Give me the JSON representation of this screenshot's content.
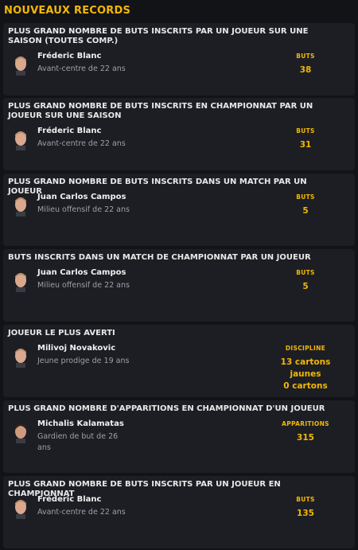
{
  "header": {
    "title": "NOUVEAUX RECORDS"
  },
  "records": [
    {
      "title": "PLUS GRAND NOMBRE DE BUTS INSCRITS PAR UN JOUEUR SUR UNE SAISON (TOUTES COMP.)",
      "player": "Fréderic Blanc",
      "desc": "Avant-centre de 22 ans",
      "stat_label": "BUTS",
      "stat_value": "38",
      "avatar_icon": "player-face-light-hair"
    },
    {
      "title": "PLUS GRAND NOMBRE DE BUTS INSCRITS EN CHAMPIONNAT PAR UN JOUEUR SUR UNE SAISON",
      "player": "Fréderic Blanc",
      "desc": "Avant-centre de 22 ans",
      "stat_label": "BUTS",
      "stat_value": "31",
      "avatar_icon": "player-face-light-hair"
    },
    {
      "title": "PLUS GRAND NOMBRE DE BUTS INSCRITS DANS UN MATCH PAR UN JOUEUR",
      "player": "Juan Carlos Campos",
      "desc": "Milieu offensif de 22 ans",
      "stat_label": "BUTS",
      "stat_value": "5",
      "avatar_icon": "player-face-light-hair"
    },
    {
      "title": "BUTS INSCRITS DANS UN MATCH DE CHAMPIONNAT PAR UN JOUEUR",
      "player": "Juan Carlos Campos",
      "desc": "Milieu offensif de 22 ans",
      "stat_label": "BUTS",
      "stat_value": "5",
      "avatar_icon": "player-face-light-hair"
    },
    {
      "title": "JOUEUR LE PLUS AVERTI",
      "player": "Milivoj Novakovic",
      "desc": "Jeune prodige de 19 ans",
      "stat_label": "DISCIPLINE",
      "stat_value": "13 cartons jaunes",
      "stat_value2": "0 cartons",
      "avatar_icon": "player-face-light-hair"
    },
    {
      "title": "PLUS GRAND NOMBRE D'APPARITIONS EN CHAMPIONNAT D'UN JOUEUR",
      "player": "Michalis Kalamatas",
      "desc": "Gardien de but de 26 ans",
      "stat_label": "APPARITIONS",
      "stat_value": "315",
      "avatar_icon": "player-face-dark-hair"
    },
    {
      "title": "PLUS GRAND NOMBRE DE BUTS INSCRITS PAR UN JOUEUR EN CHAMPIONNAT",
      "player": "Fréderic Blanc",
      "desc": "Avant-centre de 22 ans",
      "stat_label": "BUTS",
      "stat_value": "135",
      "avatar_icon": "player-face-light-hair"
    }
  ],
  "colors": {
    "accent": "#f2b705",
    "card": "#1d1e24",
    "background": "#121317"
  }
}
